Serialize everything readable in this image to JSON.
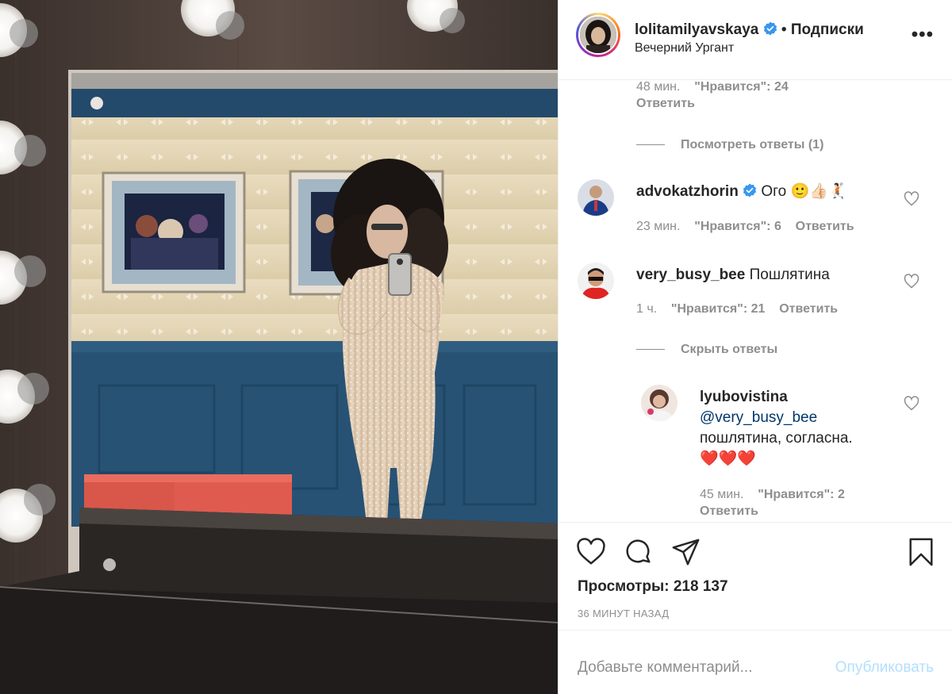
{
  "post": {
    "username": "lolitamilyavskaya",
    "separator": "•",
    "follow_label": "Подписки",
    "location": "Вечерний Ургант",
    "more_label": "•••"
  },
  "comments": {
    "top_meta": {
      "time": "48 мин.",
      "likes": "\"Нравится\": 24",
      "reply": "Ответить"
    },
    "view_replies_1": "Посмотреть ответы (1)",
    "items": [
      {
        "username": "advokatzhorin",
        "text": "Ого 🙂👍🏻🤾🏻",
        "time": "23 мин.",
        "likes": "\"Нравится\": 6",
        "reply": "Ответить"
      },
      {
        "username": "very_busy_bee",
        "text": "Пошлятина",
        "time": "1 ч.",
        "likes": "\"Нравится\": 21",
        "reply": "Ответить"
      }
    ],
    "hide_replies": "Скрыть ответы",
    "reply": {
      "username": "lyubovistina",
      "mention": "@very_busy_bee",
      "text_line": "пошлятина, согласна.",
      "hearts": "❤️❤️❤️",
      "time": "45 мин.",
      "likes": "\"Нравится\": 2",
      "reply": "Ответить"
    }
  },
  "actions": {
    "views_label": "Просмотры: 218 137",
    "time_ago": "36 минут назад"
  },
  "comment_box": {
    "placeholder": "Добавьте комментарий...",
    "post_label": "Опубликовать"
  },
  "colors": {
    "text": "#262626",
    "muted": "#8e8e8e",
    "verified": "#3897f0",
    "post_disabled": "#b2dffc",
    "heart": "#ed4956"
  },
  "icons": [
    "like-icon",
    "comment-icon",
    "share-icon",
    "save-icon",
    "verified-icon",
    "heart-icon",
    "more-icon"
  ]
}
